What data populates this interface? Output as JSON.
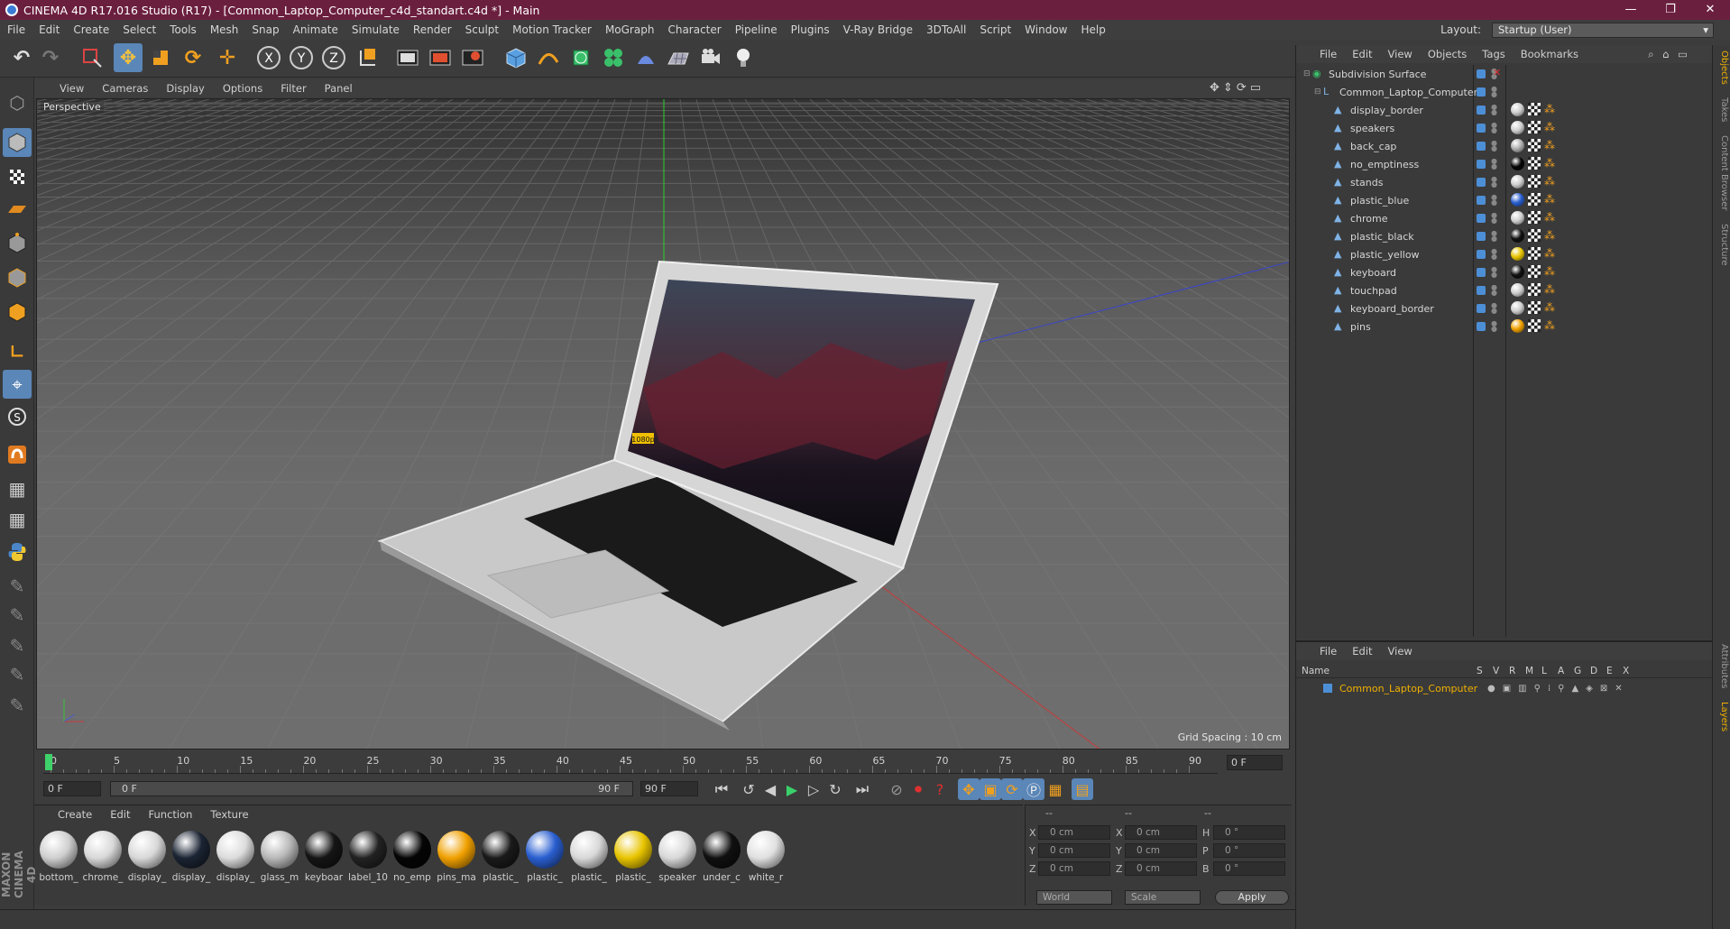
{
  "title": "CINEMA 4D R17.016 Studio (R17) - [Common_Laptop_Computer_c4d_standart.c4d *] - Main",
  "window_controls": [
    "—",
    "❐",
    "✕"
  ],
  "menu": [
    "File",
    "Edit",
    "Create",
    "Select",
    "Tools",
    "Mesh",
    "Snap",
    "Animate",
    "Simulate",
    "Render",
    "Sculpt",
    "Motion Tracker",
    "MoGraph",
    "Character",
    "Pipeline",
    "Plugins",
    "V-Ray Bridge",
    "3DToAll",
    "Script",
    "Window",
    "Help"
  ],
  "layout": {
    "label": "Layout:",
    "value": "Startup (User)"
  },
  "viewport": {
    "menu": [
      "View",
      "Cameras",
      "Display",
      "Options",
      "Filter",
      "Panel"
    ],
    "label": "Perspective",
    "grid_spacing": "Grid Spacing : 10 cm",
    "screen_badge": "1080p"
  },
  "timeline": {
    "ticks": [
      "0",
      "5",
      "10",
      "15",
      "20",
      "25",
      "30",
      "35",
      "40",
      "45",
      "50",
      "55",
      "60",
      "65",
      "70",
      "75",
      "80",
      "85",
      "90"
    ],
    "current_frame": "0 F"
  },
  "transport": {
    "start_field": "0 F",
    "range_start": "0 F",
    "range_end": "90 F",
    "end_field": "90 F"
  },
  "materials": {
    "menu": [
      "Create",
      "Edit",
      "Function",
      "Texture"
    ],
    "items": [
      {
        "name": "bottom_",
        "color": "#cfcfcf"
      },
      {
        "name": "chrome_",
        "color": "#d8d8d8"
      },
      {
        "name": "display_",
        "color": "#d8d8d8"
      },
      {
        "name": "display_",
        "color": "#1b2433"
      },
      {
        "name": "display_",
        "color": "#dcdcdc"
      },
      {
        "name": "glass_m",
        "color": "#b8b8b8"
      },
      {
        "name": "keyboar",
        "color": "#151515"
      },
      {
        "name": "label_10",
        "color": "#222222"
      },
      {
        "name": "no_emp",
        "color": "#050505"
      },
      {
        "name": "pins_ma",
        "color": "#f0a000"
      },
      {
        "name": "plastic_",
        "color": "#1a1a1a"
      },
      {
        "name": "plastic_",
        "color": "#2a5fd0"
      },
      {
        "name": "plastic_",
        "color": "#d8d8d8"
      },
      {
        "name": "plastic_",
        "color": "#e8c400"
      },
      {
        "name": "speaker",
        "color": "#d8d8d8"
      },
      {
        "name": "under_c",
        "color": "#101010"
      },
      {
        "name": "white_r",
        "color": "#e0e0e0"
      }
    ]
  },
  "coordinates": {
    "header": [
      "--",
      "--",
      "--"
    ],
    "rows": [
      {
        "a_lbl": "X",
        "a_val": "0 cm",
        "b_lbl": "X",
        "b_val": "0 cm",
        "c_lbl": "H",
        "c_val": "0 °"
      },
      {
        "a_lbl": "Y",
        "a_val": "0 cm",
        "b_lbl": "Y",
        "b_val": "0 cm",
        "c_lbl": "P",
        "c_val": "0 °"
      },
      {
        "a_lbl": "Z",
        "a_val": "0 cm",
        "b_lbl": "Z",
        "b_val": "0 cm",
        "c_lbl": "B",
        "c_val": "0 °"
      }
    ],
    "mode": "World",
    "scale": "Scale",
    "apply": "Apply"
  },
  "branding": "MAXON CINEMA 4D",
  "objects": {
    "menu": [
      "File",
      "Edit",
      "View",
      "Objects",
      "Tags",
      "Bookmarks"
    ],
    "items": [
      {
        "name": "Subdivision Surface",
        "indent": 0,
        "tag": null
      },
      {
        "name": "Common_Laptop_Computer",
        "indent": 1,
        "tag": null
      },
      {
        "name": "display_border",
        "indent": 2,
        "tag": "#cfcfcf"
      },
      {
        "name": "speakers",
        "indent": 2,
        "tag": "#cfcfcf"
      },
      {
        "name": "back_cap",
        "indent": 2,
        "tag": "#b0b0b0"
      },
      {
        "name": "no_emptiness",
        "indent": 2,
        "tag": "#050505"
      },
      {
        "name": "stands",
        "indent": 2,
        "tag": "#cfcfcf"
      },
      {
        "name": "plastic_blue",
        "indent": 2,
        "tag": "#2a5fd0"
      },
      {
        "name": "chrome",
        "indent": 2,
        "tag": "#d0d0d0"
      },
      {
        "name": "plastic_black",
        "indent": 2,
        "tag": "#111111"
      },
      {
        "name": "plastic_yellow",
        "indent": 2,
        "tag": "#e8c400"
      },
      {
        "name": "keyboard",
        "indent": 2,
        "tag": "#111111"
      },
      {
        "name": "touchpad",
        "indent": 2,
        "tag": "#cfcfcf"
      },
      {
        "name": "keyboard_border",
        "indent": 2,
        "tag": "#cfcfcf"
      },
      {
        "name": "pins",
        "indent": 2,
        "tag": "#f0a000"
      }
    ]
  },
  "layers": {
    "menu": [
      "File",
      "Edit",
      "View"
    ],
    "columns": [
      "Name",
      "S",
      "V",
      "R",
      "M",
      "L",
      "A",
      "G",
      "D",
      "E",
      "X"
    ],
    "row": "Common_Laptop_Computer"
  },
  "side_tabs": [
    "Objects",
    "Takes",
    "Content Browser",
    "Structure",
    "Attributes",
    "Layers"
  ]
}
